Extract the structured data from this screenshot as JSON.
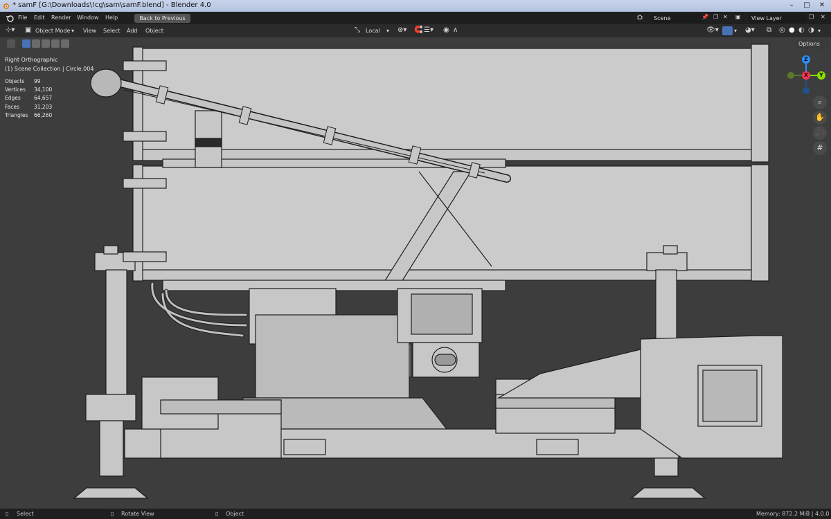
{
  "window": {
    "title": "* samF [G:\\Downloads\\!cg\\sam\\samF.blend] - Blender 4.0",
    "back_button": "Back to Previous"
  },
  "menu": {
    "items": [
      "File",
      "Edit",
      "Render",
      "Window",
      "Help"
    ],
    "scene_name": "Scene",
    "view_layer": "View Layer"
  },
  "header": {
    "mode": "Object Mode",
    "menu_items": [
      "View",
      "Select",
      "Add",
      "Object"
    ],
    "transform_orientation": "Local",
    "options_label": "Options"
  },
  "viewport": {
    "view_name": "Right Orthographic",
    "collection_info": "(1) Scene Collection | Circle.004",
    "stats": [
      {
        "label": "Objects",
        "value": "99"
      },
      {
        "label": "Vertices",
        "value": "34,100"
      },
      {
        "label": "Edges",
        "value": "64,657"
      },
      {
        "label": "Faces",
        "value": "31,203"
      },
      {
        "label": "Triangles",
        "value": "66,260"
      }
    ],
    "gizmo": {
      "z": "Z",
      "y": "Y",
      "x": "X"
    }
  },
  "statusbar": {
    "select": "Select",
    "rotate": "Rotate View",
    "object": "Object",
    "memory": "Memory: 872.2 MiB | 4.0.0"
  },
  "colors": {
    "accent_blue": "#4772b3",
    "gizmo_x": "#ff3352",
    "gizmo_y": "#8bdc00",
    "gizmo_z": "#2890ff"
  }
}
